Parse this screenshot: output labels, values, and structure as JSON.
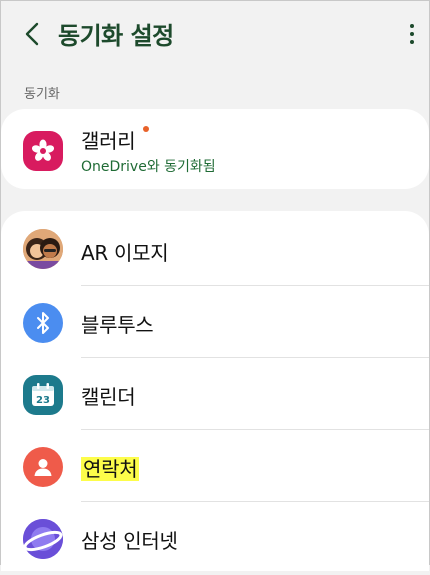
{
  "header": {
    "title": "동기화 설정"
  },
  "section": {
    "label": "동기화"
  },
  "gallery": {
    "label": "갤러리",
    "sub": "OneDrive와 동기화됨",
    "icon": "gallery-flower-icon",
    "color": "#d81b5f"
  },
  "apps": [
    {
      "label": "AR 이모지",
      "icon": "ar-emoji-avatar-icon"
    },
    {
      "label": "블루투스",
      "icon": "bluetooth-icon",
      "color": "#4b8df0"
    },
    {
      "label": "캘린더",
      "icon": "calendar-icon",
      "color": "#1d7a8c",
      "day": "23"
    },
    {
      "label": "연락처",
      "icon": "contacts-icon",
      "color": "#ef5b4a"
    },
    {
      "label": "삼성 인터넷",
      "icon": "samsung-internet-icon",
      "color": "#6a4fd8"
    }
  ]
}
